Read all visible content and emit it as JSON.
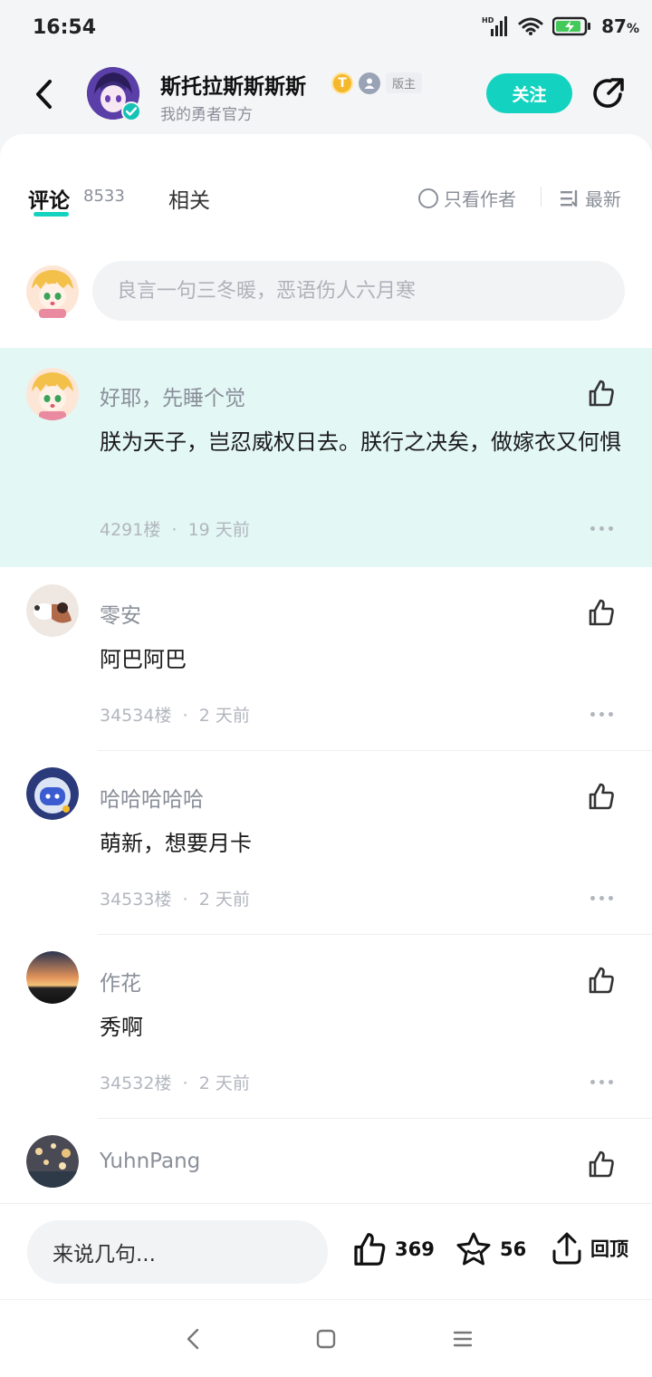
{
  "status_bar": {
    "time": "16:54",
    "network": "HD",
    "battery_pct": "87",
    "battery_unit": "%"
  },
  "header": {
    "author_name": "斯托拉斯斯斯斯",
    "badge_t": "T",
    "badge_label": "版主",
    "author_subtitle": "我的勇者官方",
    "follow_label": "关注"
  },
  "tabs": {
    "comments_label": "评论",
    "comments_count": "8533",
    "related_label": "相关",
    "only_author_label": "只看作者",
    "sort_label": "最新"
  },
  "compose": {
    "placeholder": "良言一句三冬暖，恶语伤人六月寒"
  },
  "comments": [
    {
      "name": "好耶，先睡个觉",
      "text": "朕为天子，岂忍威权日去。朕行之决矣，做嫁衣又何惧",
      "floor": "4291楼",
      "time": "19 天前",
      "avatar": "anime-avatar"
    },
    {
      "name": "零安",
      "text": "阿巴阿巴",
      "floor": "34534楼",
      "time": "2 天前",
      "avatar": "goose-avatar"
    },
    {
      "name": "哈哈哈哈哈",
      "text": "萌新，想要月卡",
      "floor": "34533楼",
      "time": "2 天前",
      "avatar": "robot-avatar"
    },
    {
      "name": "作花",
      "text": "秀啊",
      "floor": "34532楼",
      "time": "2 天前",
      "avatar": "sunset-avatar"
    },
    {
      "name": "YuhnPang",
      "text": "",
      "floor": "",
      "time": "",
      "avatar": "bokeh-avatar"
    }
  ],
  "bottom_bar": {
    "input_label": "来说几句...",
    "like_count": "369",
    "fav_count": "56",
    "top_label": "回顶"
  },
  "meta_separator": "·",
  "colors": {
    "accent": "#13d3c0",
    "highlight_bg": "#e3f7f5"
  }
}
